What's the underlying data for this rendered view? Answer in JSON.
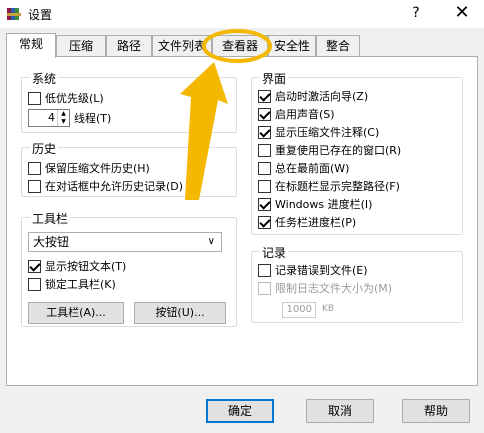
{
  "window": {
    "title": "设置",
    "help_glyph": "?",
    "close_glyph": "✕",
    "app_icon": "winrar-books-icon"
  },
  "tabs": [
    {
      "label": "常规",
      "active": true
    },
    {
      "label": "压缩"
    },
    {
      "label": "路径"
    },
    {
      "label": "文件列表"
    },
    {
      "label": "查看器"
    },
    {
      "label": "安全性"
    },
    {
      "label": "整合"
    }
  ],
  "system_group": {
    "title": "系统",
    "low_priority": "低优先级(L)",
    "threads_value": "4",
    "threads_label": "线程(T)"
  },
  "history_group": {
    "title": "历史",
    "keep_history": "保留压缩文件历史(H)",
    "allow_dialog_history": "在对话框中允许历史记录(D)"
  },
  "toolbar_group": {
    "title": "工具栏",
    "button_size": "大按钮",
    "show_text": "显示按钮文本(T)",
    "lock_toolbar": "锁定工具栏(K)",
    "toolbar_button": "工具栏(A)...",
    "buttons_button": "按钮(U)..."
  },
  "interface_group": {
    "title": "界面",
    "items": [
      {
        "label": "启动时激活向导(Z)",
        "checked": true
      },
      {
        "label": "启用声音(S)",
        "checked": true
      },
      {
        "label": "显示压缩文件注释(C)",
        "checked": true
      },
      {
        "label": "重复使用已存在的窗口(R)",
        "checked": false
      },
      {
        "label": "总在最前面(W)",
        "checked": false
      },
      {
        "label": "在标题栏显示完整路径(F)",
        "checked": false
      },
      {
        "label": "Windows 进度栏(I)",
        "checked": true
      },
      {
        "label": "任务栏进度栏(P)",
        "checked": true
      }
    ]
  },
  "log_group": {
    "title": "记录",
    "log_errors": "记录错误到文件(E)",
    "limit_size": "限制日志文件大小为(M)",
    "size_value": "1000",
    "size_unit": "KB"
  },
  "dialog_buttons": {
    "ok": "确定",
    "cancel": "取消",
    "help": "帮助"
  },
  "colors": {
    "annotation": "#f5b800",
    "default_button_border": "#0078d7"
  }
}
